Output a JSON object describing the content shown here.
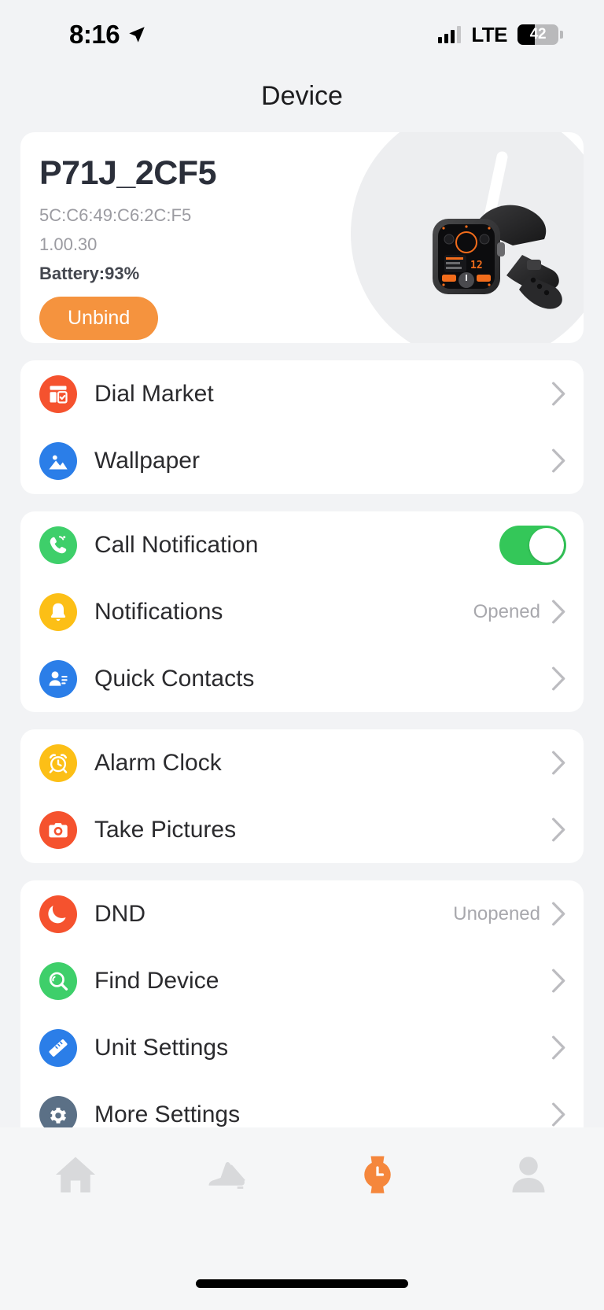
{
  "status_bar": {
    "time": "8:16",
    "location_icon": "location-arrow-icon",
    "signal_icon": "cellular-bars-icon",
    "network": "LTE",
    "battery_percent": "42",
    "battery_level": 42
  },
  "header": {
    "title": "Device"
  },
  "device_card": {
    "name": "P71J_2CF5",
    "mac_address": "5C:C6:49:C6:2C:F5",
    "firmware": "1.00.30",
    "battery": "Battery:93%",
    "unbind_label": "Unbind",
    "watch_image_alt": "smartwatch-product-photo",
    "accent_color": "#f5933e"
  },
  "groups": [
    {
      "id": "group-appearance",
      "rows": [
        {
          "id": "dial-market",
          "label": "Dial Market",
          "icon": "dial-market-icon",
          "icon_color": "#f5522e",
          "type": "chevron"
        },
        {
          "id": "wallpaper",
          "label": "Wallpaper",
          "icon": "wallpaper-icon",
          "icon_color": "#2b7ee8",
          "type": "chevron"
        }
      ]
    },
    {
      "id": "group-notifications",
      "rows": [
        {
          "id": "call-notification",
          "label": "Call Notification",
          "icon": "phone-call-icon",
          "icon_color": "#3ecf6a",
          "type": "toggle",
          "toggle_on": true
        },
        {
          "id": "notifications",
          "label": "Notifications",
          "icon": "bell-icon",
          "icon_color": "#fcbf16",
          "type": "chevron",
          "status": "Opened"
        },
        {
          "id": "quick-contacts",
          "label": "Quick Contacts",
          "icon": "contacts-icon",
          "icon_color": "#2b7ee8",
          "type": "chevron"
        }
      ]
    },
    {
      "id": "group-tools",
      "rows": [
        {
          "id": "alarm-clock",
          "label": "Alarm Clock",
          "icon": "alarm-clock-icon",
          "icon_color": "#fcbf16",
          "type": "chevron"
        },
        {
          "id": "take-pictures",
          "label": "Take Pictures",
          "icon": "camera-icon",
          "icon_color": "#f5522e",
          "type": "chevron"
        }
      ]
    },
    {
      "id": "group-system",
      "rows": [
        {
          "id": "dnd",
          "label": "DND",
          "icon": "moon-icon",
          "icon_color": "#f5522e",
          "type": "chevron",
          "status": "Unopened"
        },
        {
          "id": "find-device",
          "label": "Find Device",
          "icon": "find-device-icon",
          "icon_color": "#3ecf6a",
          "type": "chevron"
        },
        {
          "id": "unit-settings",
          "label": "Unit Settings",
          "icon": "ruler-icon",
          "icon_color": "#2b7ee8",
          "type": "chevron"
        },
        {
          "id": "more-settings",
          "label": "More Settings",
          "icon": "gear-icon",
          "icon_color": "#5b7086",
          "type": "chevron"
        }
      ]
    }
  ],
  "tab_bar": {
    "active": "device",
    "tabs": [
      {
        "id": "home",
        "icon": "home-icon",
        "active": false
      },
      {
        "id": "sport",
        "icon": "running-shoe-icon",
        "active": false
      },
      {
        "id": "device",
        "icon": "watch-icon",
        "active": true
      },
      {
        "id": "profile",
        "icon": "person-icon",
        "active": false
      }
    ],
    "active_color": "#f5873c",
    "inactive_color": "#d8d9db"
  }
}
